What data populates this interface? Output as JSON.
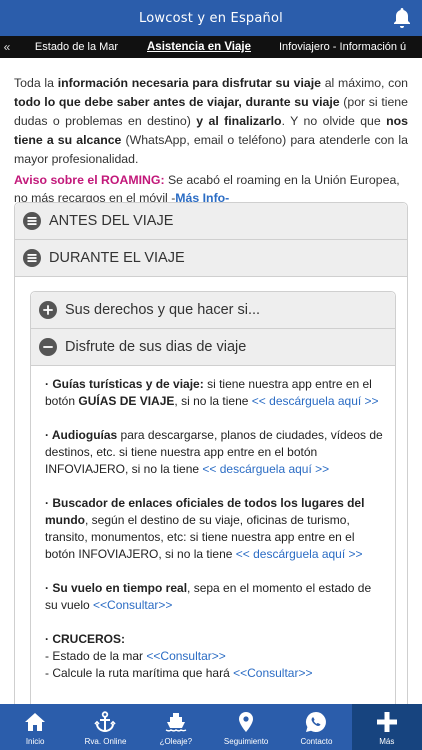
{
  "header": {
    "title": "Lowcost y en Español",
    "bell_icon": "bell-icon"
  },
  "tabs": {
    "left_arrow": "«",
    "items": [
      "Estado de la Mar",
      "Asistencia en Viaje",
      "Infoviajero - Información ú"
    ]
  },
  "intro": {
    "p1": "Toda la ",
    "b1": "información necesaria para disfrutar su viaje",
    "p2": " al máximo, con ",
    "b2": "todo lo que debe saber antes de viajar, durante su viaje",
    "p3": " (por si tiene dudas o problemas en destino) ",
    "b3": "y al finalizarlo",
    "p4": ".  Y no olvide que ",
    "b4": "nos tiene a su alcance",
    "p5": " (WhatsApp, email o teléfono) para atenderle con la mayor profesionalidad."
  },
  "roaming": {
    "label": "Aviso sobre el ROAMING:",
    "text": " Se acabó el roaming en la Unión Europea, no más recargos en el móvil -",
    "link": "Más Info",
    "end": "-"
  },
  "accordion": {
    "antes": "ANTES DEL VIAJE",
    "durante": "DURANTE EL VIAJE",
    "derechos": "Sus derechos y que hacer si...",
    "disfrute": "Disfrute de sus dias de viaje"
  },
  "list": {
    "guias_b": "· Guías turísticas y de viaje:",
    "guias_t1": " si tiene nuestra app entre en el botón ",
    "guias_b2": "GUÍAS DE VIAJE",
    "guias_t2": ", si no la tiene ",
    "guias_link": "<< descárguela aquí >>",
    "audio_b": "· Audioguías",
    "audio_t": " para descargarse, planos de ciudades, vídeos de destinos, etc. si tiene nuestra app entre en el botón INFOVIAJERO, si no la tiene ",
    "audio_link": "<< descárguela aquí >>",
    "busc_b": "· Buscador de enlaces oficiales de todos los lugares del mundo",
    "busc_t": ", según el destino de su viaje, oficinas de turismo, transito, monumentos, etc: si tiene nuestra app entre en el botón INFOVIAJERO, si no la tiene ",
    "busc_link": "<< descárguela aquí >>",
    "vuelo_b": "· Su vuelo en tiempo real",
    "vuelo_t": ", sepa en el momento el estado de su vuelo ",
    "vuelo_link": "<<Consultar>>",
    "cru_b": "· CRUCEROS:",
    "cru_1": "- Estado de la mar ",
    "cru_1_link": "<<Consultar>>",
    "cru_2": "- Calcule la ruta marítima que hará ",
    "cru_2_link": "<<Consultar>>"
  },
  "nav": [
    {
      "label": "Inicio",
      "icon": "home-icon"
    },
    {
      "label": "Rva. Online",
      "icon": "anchor-icon"
    },
    {
      "label": "¿Oleaje?",
      "icon": "ship-icon"
    },
    {
      "label": "Seguimiento",
      "icon": "map-pin-icon"
    },
    {
      "label": "Contacto",
      "icon": "whatsapp-icon"
    },
    {
      "label": "Más",
      "icon": "plus-icon"
    }
  ],
  "colors": {
    "primary": "#2b5dab",
    "active_nav": "#17447f",
    "link": "#2b6cc4",
    "alert": "#c2187a"
  }
}
